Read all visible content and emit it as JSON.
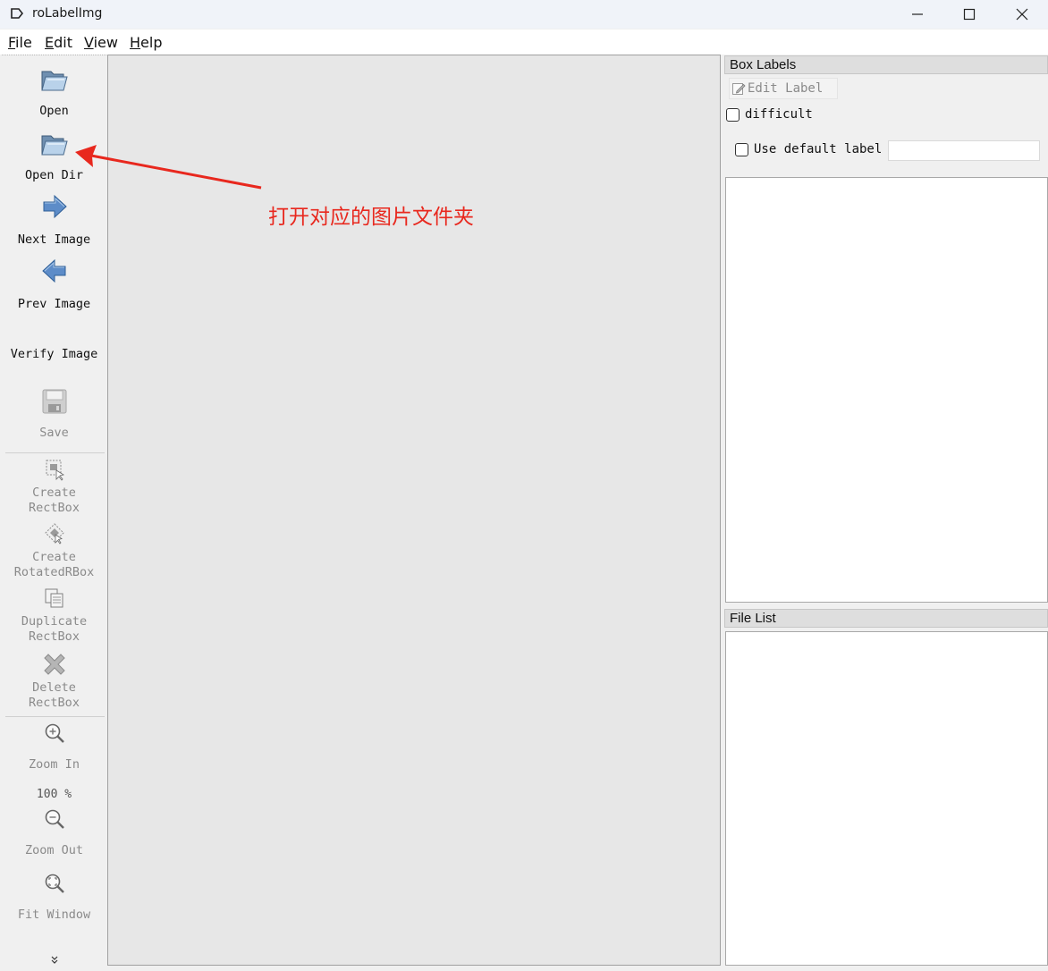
{
  "window": {
    "title": "roLabelImg",
    "controls": [
      "minimize",
      "maximize",
      "close"
    ]
  },
  "menu": [
    {
      "label": "File",
      "accel": "F",
      "rest": "ile"
    },
    {
      "label": "Edit",
      "accel": "E",
      "rest": "dit"
    },
    {
      "label": "View",
      "accel": "V",
      "rest": "iew"
    },
    {
      "label": "Help",
      "accel": "H",
      "rest": "elp"
    }
  ],
  "toolbar": {
    "open": "Open",
    "open_dir": "Open Dir",
    "next_image": "Next Image",
    "prev_image": "Prev Image",
    "verify_image": "Verify Image",
    "save": "Save",
    "create_rectbox": [
      "Create",
      "RectBox"
    ],
    "create_rotated": [
      "Create",
      "RotatedRBox"
    ],
    "duplicate_rectbox": [
      "Duplicate",
      "RectBox"
    ],
    "delete_rectbox": [
      "Delete",
      "RectBox"
    ],
    "zoom_in": "Zoom In",
    "zoom_value": "100 %",
    "zoom_out": "Zoom Out",
    "fit_window": "Fit Window"
  },
  "box_labels": {
    "title": "Box Labels",
    "edit_label": "Edit Label",
    "difficult": "difficult",
    "use_default_label": "Use default label",
    "default_label_value": ""
  },
  "file_list": {
    "title": "File List"
  },
  "annotation": {
    "text": "打开对应的图片文件夹",
    "color": "#e8281e"
  }
}
